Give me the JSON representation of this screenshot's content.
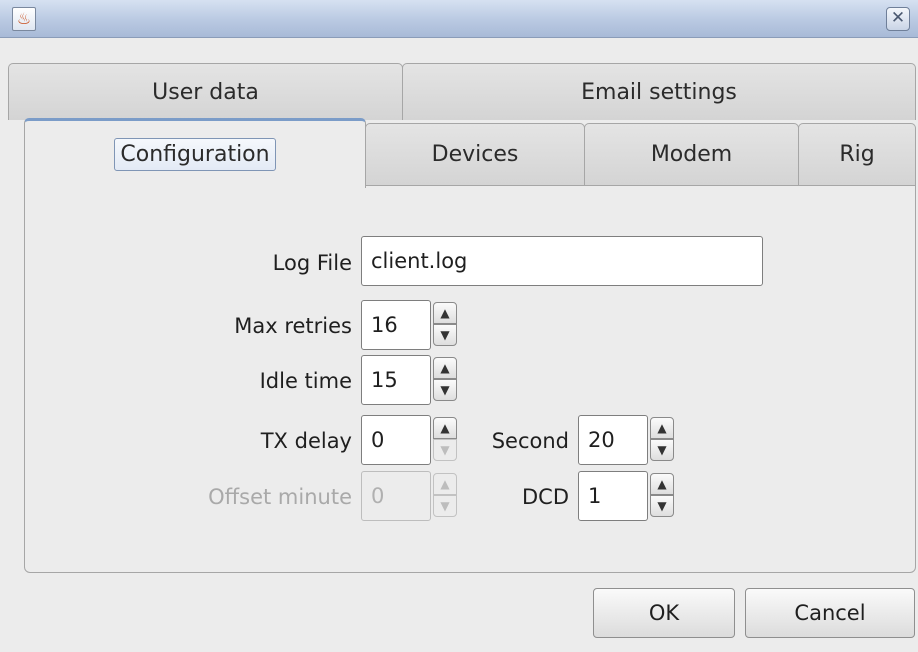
{
  "window": {
    "app_icon_glyph": "♨",
    "close_glyph": "✕"
  },
  "tabs": {
    "row1": [
      {
        "label": "User data"
      },
      {
        "label": "Email settings"
      }
    ],
    "row2": [
      {
        "label": "Configuration",
        "active": true
      },
      {
        "label": "Devices"
      },
      {
        "label": "Modem"
      },
      {
        "label": "Rig"
      }
    ]
  },
  "form": {
    "log_file": {
      "label": "Log File",
      "value": "client.log"
    },
    "max_retries": {
      "label": "Max retries",
      "value": "16"
    },
    "idle_time": {
      "label": "Idle time",
      "value": "15"
    },
    "tx_delay": {
      "label": "TX delay",
      "value": "0"
    },
    "second": {
      "label": "Second",
      "value": "20"
    },
    "offset_minute": {
      "label": "Offset minute",
      "value": "0",
      "disabled": true
    },
    "dcd": {
      "label": "DCD",
      "value": "1"
    }
  },
  "spinner_glyphs": {
    "up": "▲",
    "down": "▼"
  },
  "buttons": {
    "ok": "OK",
    "cancel": "Cancel"
  }
}
